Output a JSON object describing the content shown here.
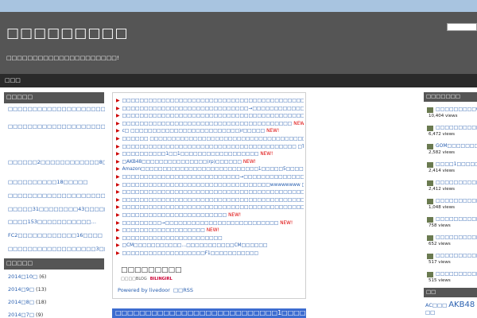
{
  "header": {
    "title": "□□□□□□□□□",
    "description": "□□□□□□□□□□□□□□□□□□□□□!",
    "nav_home": "□□□"
  },
  "left": {
    "widget1_title": "□□□□□",
    "posts": [
      "□□□□□□□□□□□□□□□□□□□□□□□□□□1□□□□□□□",
      "□□□□□□□□□□□□□□□□□□□□□□□□□□□□□□□□□□□",
      "□□□□□□2□□□□□□□□□□□□8□□□□□□□□□□□",
      "□□□□□□□□□□18□□□□□",
      "□□□□□□□□□□□□□□□□□□□□□□□□□",
      "□□□□□31□□□□□□□□43□□□□□□…",
      "□□□□153□□□□□□□□□□□…",
      "FC2□□□□□□□□□□□□16□□□□",
      "□□□□□□□□□□□□□□□□□□3□□□□□□□□"
    ],
    "widget2_title": "□□□□□",
    "archives": [
      {
        "label": "2014□10□",
        "count": "(6)"
      },
      {
        "label": "2014□9□",
        "count": "(13)"
      },
      {
        "label": "2014□8□",
        "count": "(18)"
      },
      {
        "label": "2014□7□",
        "count": "(9)"
      }
    ]
  },
  "center": {
    "new_label": "NEW!",
    "items": [
      {
        "text": "□□□□□□□□□□□□□□□□□□□□□□□□□□□□□□□□□□□□□□□□□□□□□□□...",
        "new": true
      },
      {
        "text": "□□□□□□□□□□□□□□□□□□□□□□□□□□□□□→□□□□□□□□□□□□□□□□□□",
        "new": true
      },
      {
        "text": "□□□□□□□□□□□□□□□□□□□□□□□□□□□□□□□□□□□□□□□□□□□□□□□□□□□□□□□□□□□□□",
        "new": true
      },
      {
        "text": "□□□□□□□□□□□□□□□□□□□□□□□□□□□□□□□□□□□□□□□",
        "new": true
      },
      {
        "text": "c□ □□□□□□□□□□□□□□□□□□□□□□□□□)r□□□□□",
        "new": true
      },
      {
        "text": "□□□□□□ □□□□□□□□□□□□□□□□□□□□□□□□□□□□□□□□□□□□□□□□□□...□",
        "new": true
      },
      {
        "text": "□□□□□□□□□□□□□□□□□□□□□□□□□□□□□□□□□□□□□□□□ □TOP30□□□□□",
        "new": true
      },
      {
        "text": "□□□□□□□□□□1□□1□□□□□□□□□□□□□□□□□□",
        "new": true
      },
      {
        "text": "□AKB48□□□□□□□□□□□□□□□(rp)□□□□□□",
        "new": true
      },
      {
        "text": "Amazon□□□□□□□□□□□□□□□□□□□□□□□□□□□1□□□□□5□□□□□",
        "new": true
      },
      {
        "text": "□□□□□□□□□□□□□□□□□□□□□□□□□□□→□□□□□□□□□□□□□□□□□□□□□□□[10/16]",
        "new": true
      },
      {
        "text": "□□□□□□□□□□□□□□□□□□□□□□□□□□□□□□□□□□wwwwwwww □",
        "new": true
      },
      {
        "text": "□□□□□□□□□□□□□□□□□□□□□□□□□□□□□□□□□□□□□□□□□□",
        "new": true
      },
      {
        "text": "□□□□□□□□□□□□□□□□□□□□□□□□□□□□□□□□□□□□□□□□□□□□□□□□□□□□□□□□□",
        "new": true
      },
      {
        "text": "□□□□□□□□□□□□□□□□□□□□□□□□□□□□□□□□□□□□□□□□□□□□□□□□□□□□□→□□□□□□",
        "new": true
      },
      {
        "text": "□□□□□□□□□□□□□□□□□□□□□□□□",
        "new": true
      },
      {
        "text": "□□□□□□□□□→□□□□□□□□□□□□□□□□□□□□□□□□□□",
        "new": true
      },
      {
        "text": "□□□□□□□□□□□□□□□□□□□",
        "new": true
      },
      {
        "text": "□□□□□□□□□□□□□□□□□□□□□□□",
        "new": false
      },
      {
        "text": "□CM□□□□□□□□□□□…□□□□□□□□□□□CM□□□□□□",
        "new": false
      },
      {
        "text": "□□□□□□□□□□□□□□□□□□□F1□□□□□□□□□□□",
        "new": false
      }
    ],
    "logo_main": "□□□□□□□□□",
    "logo_sub": "□□□□BLOG",
    "logo_brand": "BILINGIRL",
    "powered": "Powered by livedoor",
    "rss": "□□RSS",
    "bluebar_title": "□□□□□□□□□□□□□□□□□□□□□□□□□□□1□□□□□□□□"
  },
  "right": {
    "rank_title": "□□□□□□□",
    "ranks": [
      {
        "title": "□□□□□□□□□0...",
        "views": "10,404 views"
      },
      {
        "title": "□□□□□□□□□□□",
        "views": "6,472 views"
      },
      {
        "title": "GOM□□□□□□□□",
        "views": "2,582 views"
      },
      {
        "title": "□□□□1□□□□□□",
        "views": "2,414 views"
      },
      {
        "title": "□□□□□□□□□□□",
        "views": "2,412 views"
      },
      {
        "title": "□□□□□□□□□□□",
        "views": "1,048 views"
      },
      {
        "title": "□□□□□□□□□□□",
        "views": "758 views"
      },
      {
        "title": "□□□□□□□□□□DL□",
        "views": "652 views"
      },
      {
        "title": "□□□□□□□□□□□",
        "views": "517 views"
      },
      {
        "title": "□□□□□□□□□□□",
        "views": "515 views"
      }
    ],
    "tags_title": "□□",
    "tag_ac": "AC□□□",
    "tag_akb": "AKB48",
    "tag_other": "□□"
  },
  "colors": {
    "link": "#2a60b0",
    "new_badge": "#dd0000",
    "header_bg": "#555555",
    "accent_blue": "#3c6cd0"
  }
}
